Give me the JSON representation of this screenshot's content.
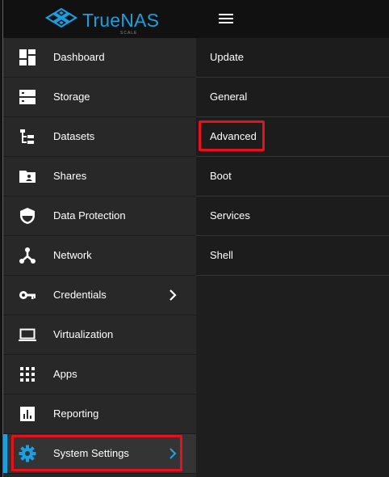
{
  "header": {
    "brand": "TrueNAS",
    "brand_sub": "SCALE",
    "menu_icon": "hamburger-menu-icon"
  },
  "sidebar": {
    "items": [
      {
        "label": "Dashboard",
        "icon": "dashboard-icon"
      },
      {
        "label": "Storage",
        "icon": "storage-icon"
      },
      {
        "label": "Datasets",
        "icon": "datasets-icon"
      },
      {
        "label": "Shares",
        "icon": "shares-icon"
      },
      {
        "label": "Data Protection",
        "icon": "shield-icon"
      },
      {
        "label": "Network",
        "icon": "network-icon"
      },
      {
        "label": "Credentials",
        "icon": "key-icon",
        "has_submenu": true
      },
      {
        "label": "Virtualization",
        "icon": "laptop-icon"
      },
      {
        "label": "Apps",
        "icon": "apps-grid-icon"
      },
      {
        "label": "Reporting",
        "icon": "reporting-icon"
      },
      {
        "label": "System Settings",
        "icon": "gear-icon",
        "has_submenu": true,
        "active": true
      }
    ]
  },
  "submenu": {
    "items": [
      {
        "label": "Update"
      },
      {
        "label": "General"
      },
      {
        "label": "Advanced",
        "highlighted": true
      },
      {
        "label": "Boot"
      },
      {
        "label": "Services"
      },
      {
        "label": "Shell"
      }
    ]
  },
  "colors": {
    "accent": "#1a9fe0",
    "highlight_outline": "#e8111b",
    "sidebar_bg": "#282828",
    "topbar_bg": "#111111"
  }
}
